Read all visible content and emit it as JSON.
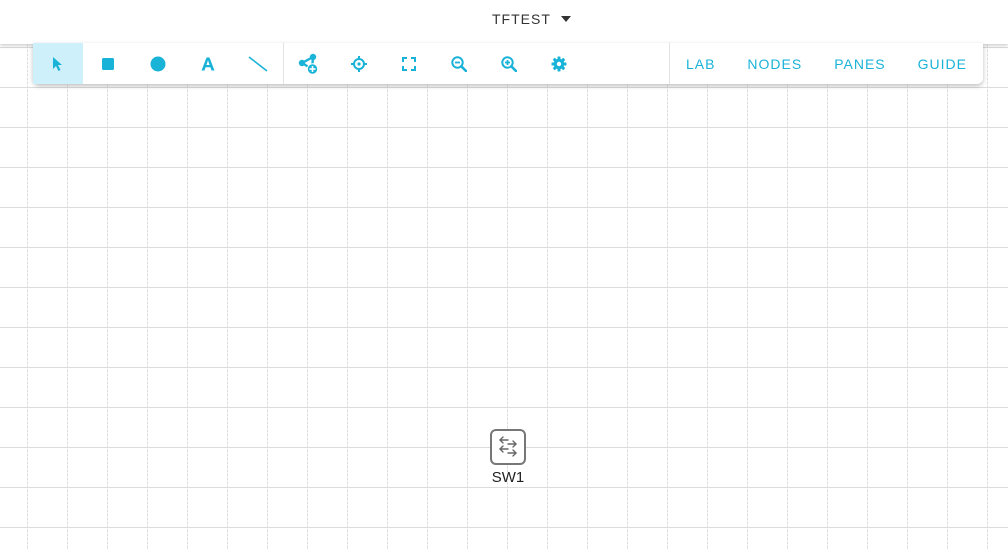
{
  "header": {
    "lab_name": "TFTEST"
  },
  "toolbar": {
    "tools": [
      {
        "name": "select",
        "icon": "pointer-arrow-icon",
        "active": true
      },
      {
        "name": "rectangle",
        "icon": "square-icon"
      },
      {
        "name": "ellipse",
        "icon": "circle-icon"
      },
      {
        "name": "text",
        "icon": "text-a-icon"
      },
      {
        "name": "line",
        "icon": "line-icon"
      },
      {
        "name": "add-node",
        "icon": "add-node-icon"
      },
      {
        "name": "center",
        "icon": "crosshair-icon"
      },
      {
        "name": "fit",
        "icon": "fit-screen-icon"
      },
      {
        "name": "zoom-out",
        "icon": "zoom-out-icon"
      },
      {
        "name": "zoom-in",
        "icon": "zoom-in-icon"
      },
      {
        "name": "settings",
        "icon": "gear-icon"
      }
    ],
    "menu": {
      "lab": "LAB",
      "nodes": "NODES",
      "panes": "PANES",
      "guide": "GUIDE"
    }
  },
  "canvas": {
    "nodes": [
      {
        "label": "SW1",
        "icon": "switch-icon"
      }
    ]
  },
  "colors": {
    "accent": "#1ab3d8",
    "active_tool_bg": "#cdf0fb",
    "grid": "#dcdcdc",
    "node_border": "#777777"
  }
}
